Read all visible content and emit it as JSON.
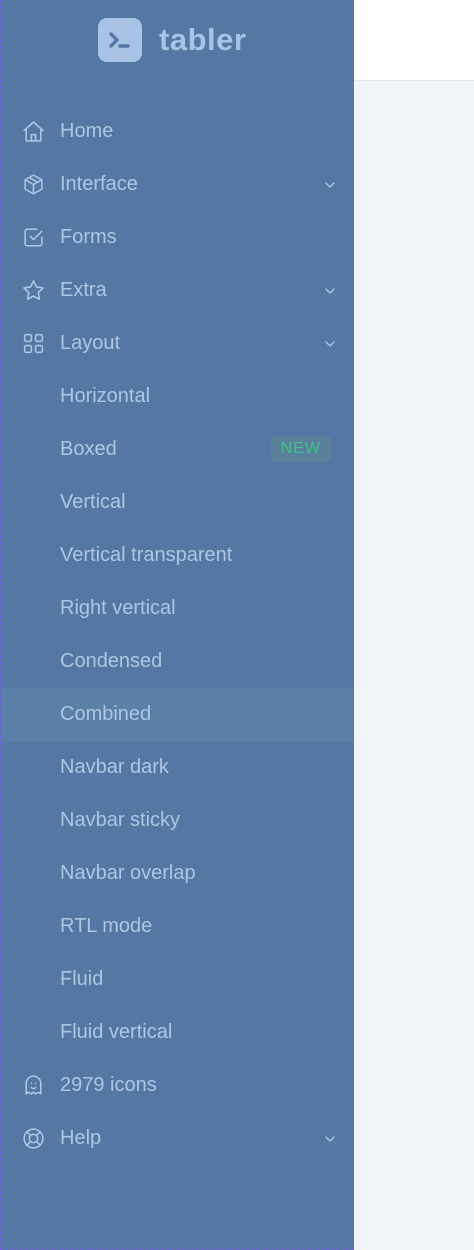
{
  "brand": {
    "name": "tabler"
  },
  "colors": {
    "sidebar_bg": "#5478a3",
    "text": "#aec6e4",
    "active_bg": "#5a80a8",
    "badge_text": "#3ec28c",
    "page_bg": "#f1f5f9"
  },
  "nav": {
    "home": "Home",
    "interface": "Interface",
    "forms": "Forms",
    "extra": "Extra",
    "layout": "Layout",
    "layout_items": [
      "Horizontal",
      "Boxed",
      "Vertical",
      "Vertical transparent",
      "Right vertical",
      "Condensed",
      "Combined",
      "Navbar dark",
      "Navbar sticky",
      "Navbar overlap",
      "RTL mode",
      "Fluid",
      "Fluid vertical"
    ],
    "boxed_badge": "NEW",
    "icons": "2979 icons",
    "help": "Help"
  },
  "active_item": "Combined",
  "icon_names": [
    "home-icon",
    "package-icon",
    "checkbox-icon",
    "star-icon",
    "layout-grid-icon",
    "ghost-icon",
    "lifebuoy-icon",
    "chevron-down-icon",
    "terminal-icon"
  ]
}
